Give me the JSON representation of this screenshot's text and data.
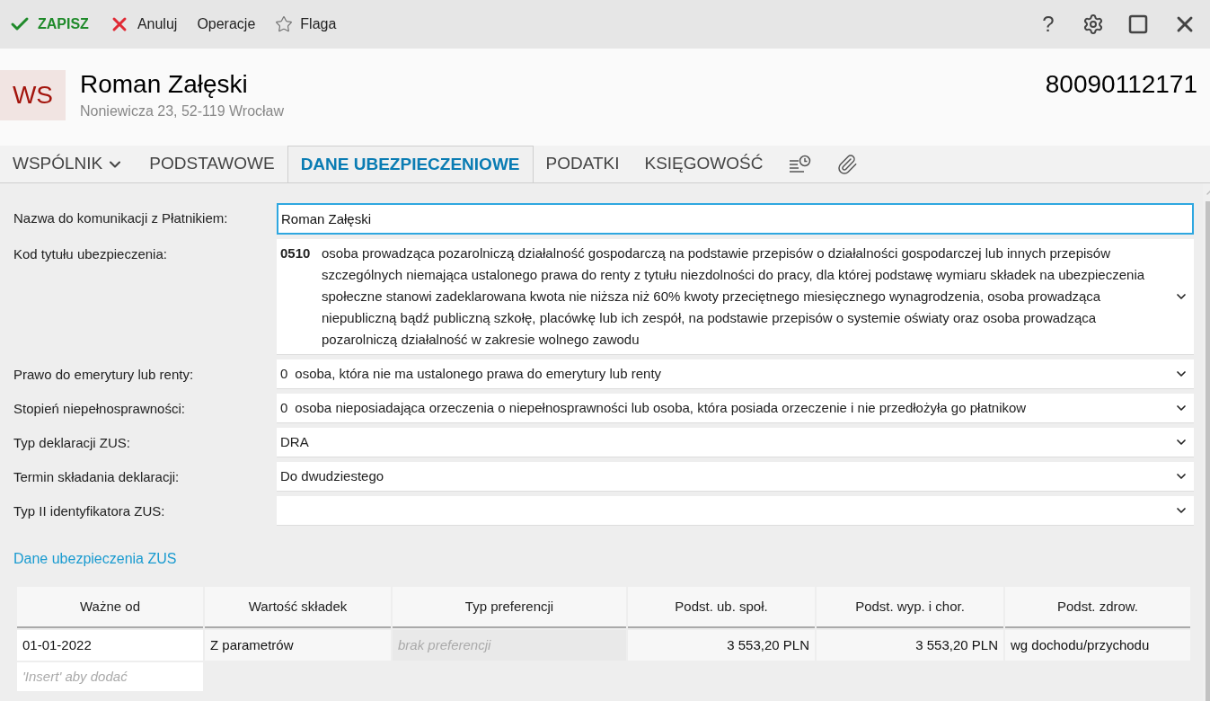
{
  "toolbar": {
    "actions": [
      {
        "kind": "save",
        "label": "ZAPISZ"
      },
      {
        "kind": "cancel",
        "label": "Anuluj"
      },
      {
        "kind": "plain",
        "label": "Operacje"
      },
      {
        "kind": "flag",
        "label": "Flaga"
      }
    ],
    "window_controls": {
      "help": "?"
    }
  },
  "header": {
    "initials": "WS",
    "name": "Roman Załęski",
    "address": "Noniewicza 23, 52-119 Wrocław",
    "number": "80090112171"
  },
  "tabs": [
    {
      "kind": "dropdown",
      "label": "WSPÓLNIK",
      "selected": false
    },
    {
      "kind": "text",
      "label": "PODSTAWOWE",
      "selected": false
    },
    {
      "kind": "text",
      "label": "DANE UBEZPIECZENIOWE",
      "selected": true
    },
    {
      "kind": "text",
      "label": "PODATKI",
      "selected": false
    },
    {
      "kind": "text",
      "label": "KSIĘGOWOŚĆ",
      "selected": false
    },
    {
      "kind": "history",
      "selected": false
    },
    {
      "kind": "attachments",
      "selected": false
    }
  ],
  "form": [
    {
      "kind": "input",
      "label": "Nazwa do komunikacji z Płatnikiem:",
      "value": "Roman Załęski"
    },
    {
      "kind": "select",
      "label": "Kod tytułu ubezpieczenia:",
      "code": "0510",
      "bold_code": true,
      "value": "osoba prowadząca pozarolniczą działalność gospodarczą na podstawie przepisów o działalności gospodarczej lub innych przepisów szczególnych niemająca ustalonego prawa do renty z tytułu niezdolności do pracy, dla której podstawę wymiaru składek na ubezpieczenia społeczne stanowi zadeklarowana kwota nie niższa niż 60% kwoty przeciętnego miesięcznego wynagrodzenia, osoba prowadząca niepubliczną bądź publiczną szkołę, placówkę lub ich zespół, na podstawie przepisów o systemie oświaty oraz osoba prowadząca pozarolniczą działalność w zakresie wolnego zawodu"
    },
    {
      "kind": "select",
      "label": "Prawo do emerytury lub renty:",
      "code": "0",
      "bold_code": false,
      "value": "osoba, która nie ma ustalonego prawa do emerytury lub renty"
    },
    {
      "kind": "select",
      "label": "Stopień niepełnosprawności:",
      "code": "0",
      "bold_code": false,
      "value": "osoba nieposiadająca orzeczenia o niepełnosprawności lub osoba, która posiada orzeczenie i nie przedłożyła go płatnikow"
    },
    {
      "kind": "select",
      "label": "Typ deklaracji ZUS:",
      "value": "DRA"
    },
    {
      "kind": "select",
      "label": "Termin składania deklaracji:",
      "value": "Do dwudziestego"
    },
    {
      "kind": "select",
      "label": "Typ II identyfikatora ZUS:"
    }
  ],
  "zus_section": {
    "title": "Dane ubezpieczenia ZUS",
    "columns": [
      "Ważne od",
      "Wartość składek",
      "Typ preferencji",
      "Podst. ub. społ.",
      "Podst. wyp. i chor.",
      "Podst. zdrow."
    ],
    "rows": [
      {
        "cells": [
          "01-01-2022",
          "Z parametrów",
          "brak preferencji",
          "3 553,20 PLN",
          "3 553,20 PLN",
          "wg dochodu/przychodu"
        ]
      }
    ],
    "new_row_placeholder": "'Insert' aby dodać"
  }
}
